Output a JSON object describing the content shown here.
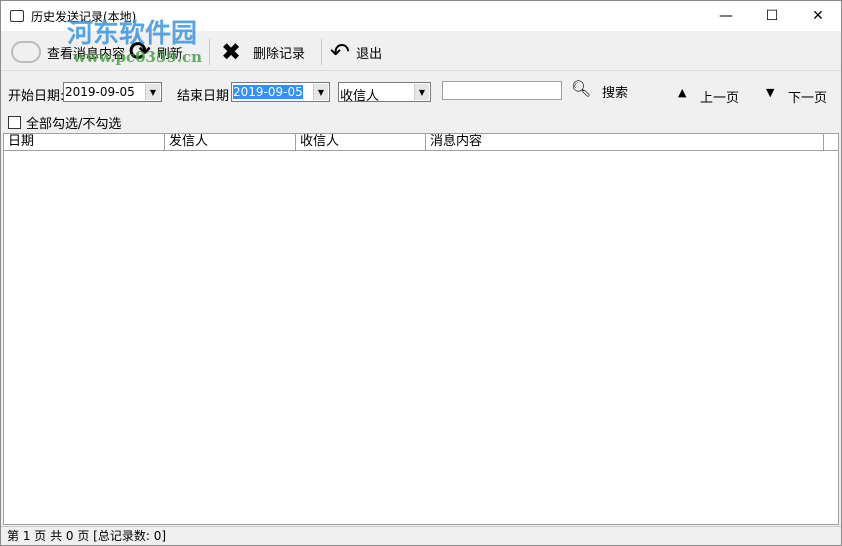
{
  "window": {
    "title": "历史发送记录(本地)",
    "minimize": "—",
    "maximize": "☐",
    "close": "✕"
  },
  "toolbar": {
    "view": "查看消息内容",
    "refresh": "刷新",
    "delete": "删除记录",
    "exit": "退出"
  },
  "filter": {
    "start_label": "开始日期:",
    "start_value": "2019-09-05",
    "end_label": "结束日期",
    "end_value": "2019-09-05",
    "field_value": "收信人",
    "search_value": "",
    "search_label": "搜索",
    "prev": "上一页",
    "next": "下一页"
  },
  "select_all": "全部勾选/不勾选",
  "table": {
    "columns": [
      "日期",
      "发信人",
      "收信人",
      "消息内容"
    ]
  },
  "status": "第 1 页 共 0 页  [总记录数: 0]",
  "watermark": {
    "name": "河东软件园",
    "url": "www.pc0359.cn"
  }
}
